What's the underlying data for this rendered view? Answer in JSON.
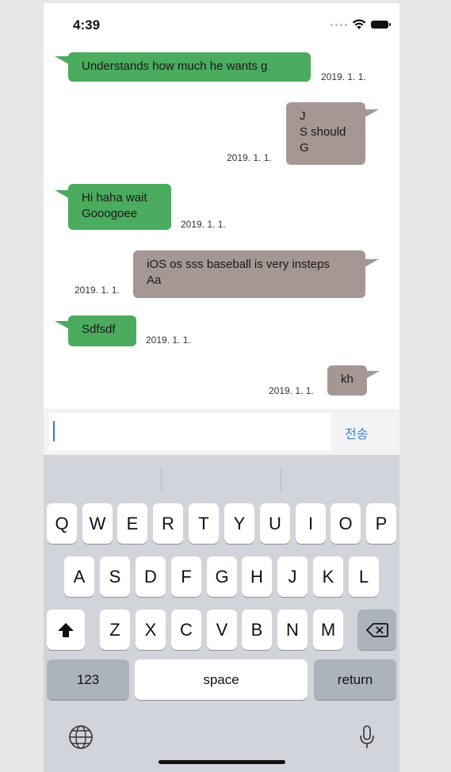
{
  "status_bar": {
    "time": "4:39"
  },
  "messages": [
    {
      "side": "left",
      "text": "Understands how much he wants g",
      "date": "2019. 1. 1."
    },
    {
      "side": "right",
      "text": "J\nS should\nG",
      "date": "2019. 1. 1."
    },
    {
      "side": "left",
      "text": "Hi haha wait\nGooogoee",
      "date": "2019. 1. 1."
    },
    {
      "side": "right",
      "text": "iOS os sss baseball is very insteps\nAa",
      "date": "2019. 1. 1."
    },
    {
      "side": "left",
      "text": "Sdfsdf",
      "date": "2019. 1. 1."
    },
    {
      "side": "right",
      "text": "kh",
      "date": "2019. 1. 1."
    }
  ],
  "input": {
    "value": "",
    "send_label": "전송"
  },
  "keyboard": {
    "row1": [
      "Q",
      "W",
      "E",
      "R",
      "T",
      "Y",
      "U",
      "I",
      "O",
      "P"
    ],
    "row2": [
      "A",
      "S",
      "D",
      "F",
      "G",
      "H",
      "J",
      "K",
      "L"
    ],
    "row3": [
      "Z",
      "X",
      "C",
      "V",
      "B",
      "N",
      "M"
    ],
    "numbers_label": "123",
    "space_label": "space",
    "return_label": "return"
  },
  "icons": {
    "shift": "shift-icon",
    "backspace": "backspace-icon",
    "globe": "globe-icon",
    "mic": "microphone-icon",
    "wifi": "wifi-icon",
    "battery": "battery-icon"
  }
}
